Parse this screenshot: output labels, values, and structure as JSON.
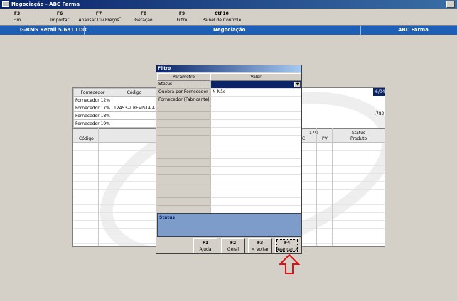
{
  "window": {
    "title": "Negociação - ABC Farma",
    "minimize_label": "_"
  },
  "toolbar": {
    "items": [
      {
        "key": "F3",
        "label": "Fim"
      },
      {
        "key": "F6",
        "label": "Importar"
      },
      {
        "key": "F7",
        "label": "Analisar Div.Preços"
      },
      {
        "key": "F8",
        "label": "Geração"
      },
      {
        "key": "F9",
        "label": "Filtro"
      },
      {
        "key": "CtF10",
        "label": "Painel de Controle"
      }
    ],
    "separator": "-"
  },
  "header": {
    "left": "G-RMS Retail 5.681 LDR",
    "center": "Negociação",
    "right": "ABC Farma"
  },
  "background": {
    "columns": [
      "Fornecedor",
      "Código"
    ],
    "rows": [
      {
        "fornecedor": "Fornecedor 12%",
        "codigo": "",
        "extra": ""
      },
      {
        "fornecedor": "Fornecedor 17%",
        "codigo": "12453-2",
        "extra": "REVISTA A"
      },
      {
        "fornecedor": "Fornecedor 18%",
        "codigo": "",
        "extra": ""
      },
      {
        "fornecedor": "Fornecedor 19%",
        "codigo": "",
        "extra": ""
      }
    ],
    "selected_text": "6/04/16  (6.782 Produtos)",
    "side_value": ".782",
    "lower": {
      "codigo": "Código",
      "pct": "17%",
      "c": "C",
      "pv": "PV",
      "status": "Status",
      "produto": "Produto"
    }
  },
  "filter_dialog": {
    "title": "Filtro",
    "col_param": "Parâmetro",
    "col_value": "Valor",
    "rows": [
      {
        "param": "Status",
        "value": ""
      },
      {
        "param": "Quebra por Fornecedor (F",
        "value": "N-Não"
      },
      {
        "param": "Fornecedor (Fabricante)",
        "value": ""
      }
    ],
    "status_label": "Status",
    "buttons": [
      {
        "key": "F1",
        "label": "Ajuda"
      },
      {
        "key": "F2",
        "label": "Geral"
      },
      {
        "key": "F3",
        "label": "< Voltar"
      },
      {
        "key": "F4",
        "label": "Avançar >"
      }
    ]
  },
  "colors": {
    "header_blue": "#1d5fb6",
    "status_blue": "#7d9cc9",
    "arrow_red": "#e01010"
  }
}
